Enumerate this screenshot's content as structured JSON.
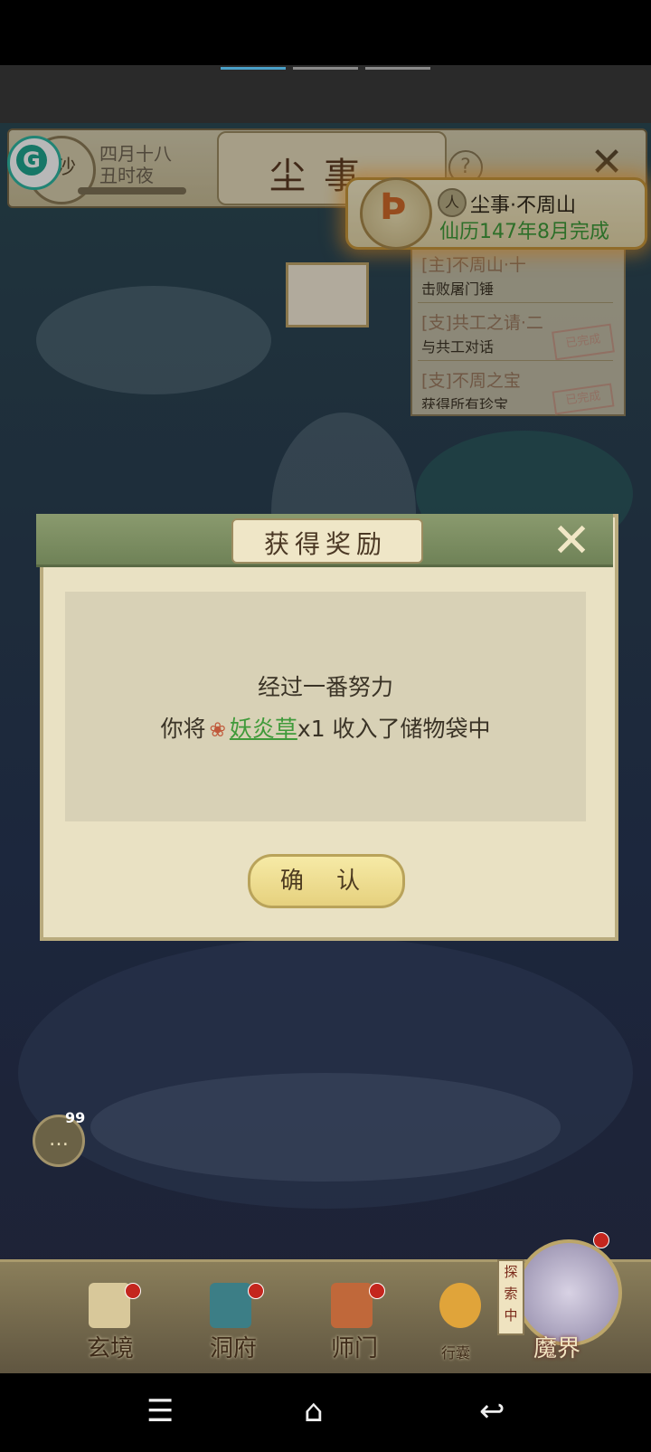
{
  "topbar": {
    "avatar_char": "沙",
    "date_line1": "四月十八",
    "date_line2": "丑时夜",
    "title": "尘事",
    "help": "?"
  },
  "quest_banner": {
    "name": "尘事·不周山",
    "status": "仙历147年8月完成"
  },
  "quest_list": [
    {
      "title": "[主]不周山·十",
      "desc": "击败屠门锤",
      "stamp": ""
    },
    {
      "title": "[支]共工之请·二",
      "desc": "与共工对话",
      "stamp": "已完成"
    },
    {
      "title": "[支]不周之宝",
      "desc": "获得所有珍宝",
      "stamp": "已完成"
    }
  ],
  "dialog": {
    "title": "获得奖励",
    "line1": "经过一番努力",
    "line2_prefix": "你将",
    "item_name": "妖炎草",
    "line2_suffix": "x1 收入了储物袋中",
    "confirm": "确 认"
  },
  "chat": {
    "count": "99"
  },
  "bottom_nav": [
    {
      "label": "玄境"
    },
    {
      "label": "洞府"
    },
    {
      "label": "师门"
    },
    {
      "label": "行囊"
    },
    {
      "label": "魔界"
    }
  ],
  "explore_tag": "探索中",
  "colors": {
    "accent_green": "#3f9a3a",
    "dialog_bg": "#e9e1c3",
    "header_green": "#6f8257"
  },
  "icons": [
    "g-assistant-icon",
    "help-icon",
    "close-icon",
    "quest-emblem-icon",
    "person-icon",
    "herb-icon",
    "chat-icon",
    "menu-icon",
    "home-icon",
    "back-icon"
  ]
}
